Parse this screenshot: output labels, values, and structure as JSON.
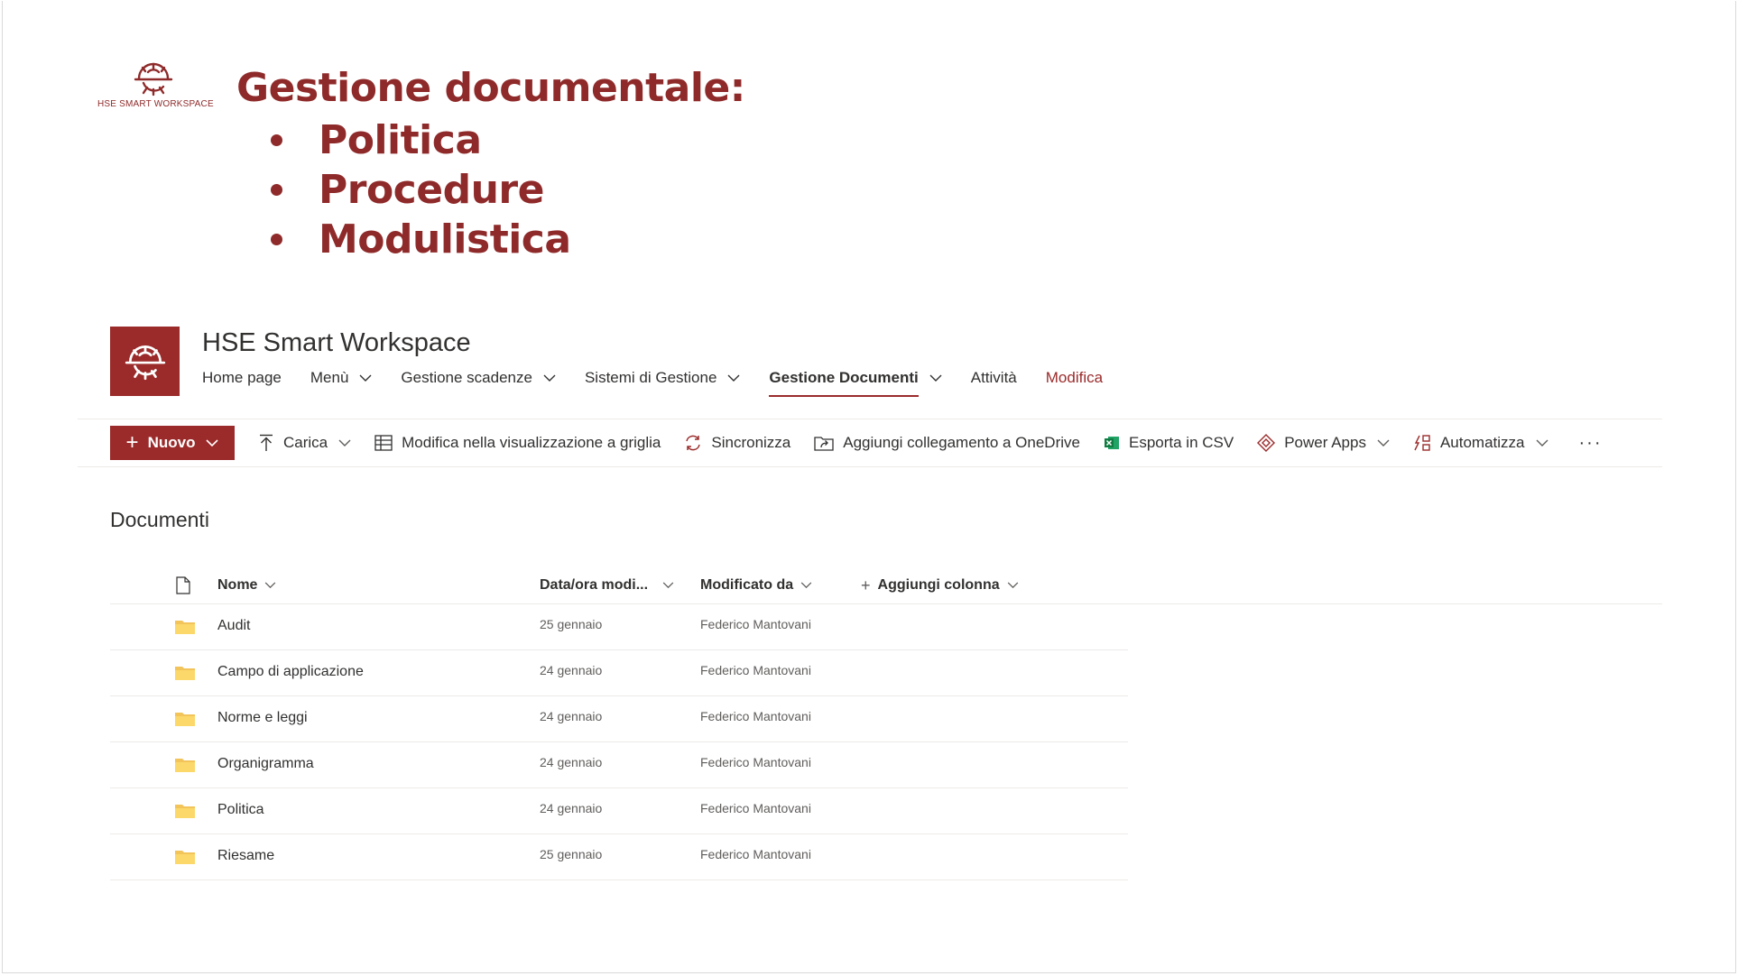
{
  "slide": {
    "brand_text": "HSE SMART WORKSPACE",
    "title": "Gestione documentale:",
    "bullets": [
      "Politica",
      "Procedure",
      "Modulistica"
    ],
    "accent_color": "#8f2a2a"
  },
  "site": {
    "title": "HSE Smart Workspace",
    "logo_color": "#9b2b2b",
    "nav": [
      {
        "label": "Home page",
        "dropdown": false
      },
      {
        "label": "Menù",
        "dropdown": true
      },
      {
        "label": "Gestione scadenze",
        "dropdown": true
      },
      {
        "label": "Sistemi di Gestione",
        "dropdown": true
      },
      {
        "label": "Gestione Documenti",
        "dropdown": true,
        "active": true
      },
      {
        "label": "Attività",
        "dropdown": false
      },
      {
        "label": "Modifica",
        "dropdown": false
      }
    ]
  },
  "commandbar": {
    "new_label": "Nuovo",
    "upload_label": "Carica",
    "grid_edit_label": "Modifica nella visualizzazione a griglia",
    "sync_label": "Sincronizza",
    "onedrive_label": "Aggiungi collegamento a OneDrive",
    "csv_label": "Esporta in CSV",
    "powerapps_label": "Power Apps",
    "automate_label": "Automatizza",
    "more_label": "···"
  },
  "library": {
    "title": "Documenti",
    "columns": {
      "name": "Nome",
      "modified": "Data/ora modi...",
      "modified_by": "Modificato da",
      "add_column": "Aggiungi colonna"
    },
    "rows": [
      {
        "name": "Audit",
        "modified": "25 gennaio",
        "modified_by": "Federico Mantovani"
      },
      {
        "name": "Campo di applicazione",
        "modified": "24 gennaio",
        "modified_by": "Federico Mantovani"
      },
      {
        "name": "Norme e leggi",
        "modified": "24 gennaio",
        "modified_by": "Federico Mantovani"
      },
      {
        "name": "Organigramma",
        "modified": "24 gennaio",
        "modified_by": "Federico Mantovani"
      },
      {
        "name": "Politica",
        "modified": "24 gennaio",
        "modified_by": "Federico Mantovani"
      },
      {
        "name": "Riesame",
        "modified": "25 gennaio",
        "modified_by": "Federico Mantovani"
      }
    ]
  }
}
